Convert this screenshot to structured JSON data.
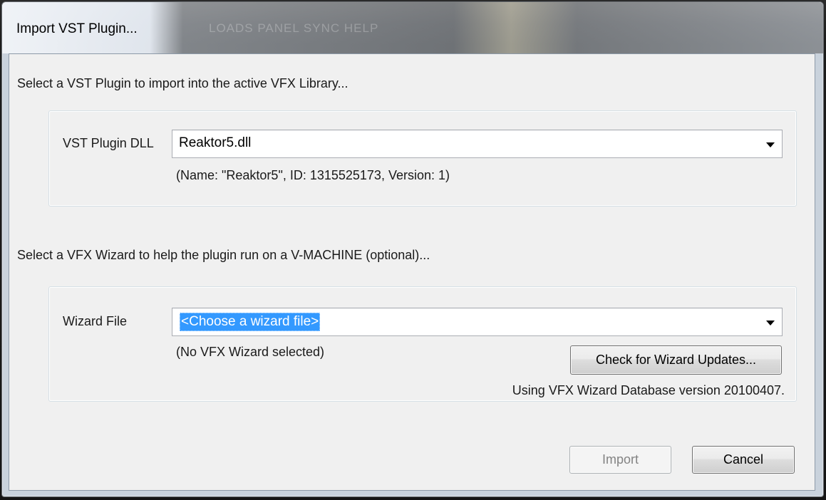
{
  "window": {
    "title": "Import VST Plugin...",
    "background_menu_ghost": "LOADS PANEL SYNC HELP"
  },
  "plugin_section": {
    "instruction": "Select a VST Plugin to import into the active VFX Library...",
    "dll_label": "VST Plugin DLL",
    "dll_value": "Reaktor5.dll",
    "dll_info": "(Name: \"Reaktor5\", ID: 1315525173, Version: 1)"
  },
  "wizard_section": {
    "instruction": "Select a VFX Wizard to help the plugin run on a V-MACHINE (optional)...",
    "file_label": "Wizard File",
    "file_value": "<Choose a wizard file>",
    "status": "(No VFX Wizard selected)",
    "check_updates_label": "Check for Wizard Updates...",
    "database_info": "Using VFX Wizard Database version 20100407."
  },
  "actions": {
    "import_label": "Import",
    "import_enabled": false,
    "cancel_label": "Cancel"
  },
  "colors": {
    "selection_highlight": "#3399ff",
    "client_background": "#f0f0f0"
  },
  "icons": {
    "dropdown": "chevron-down-icon"
  }
}
